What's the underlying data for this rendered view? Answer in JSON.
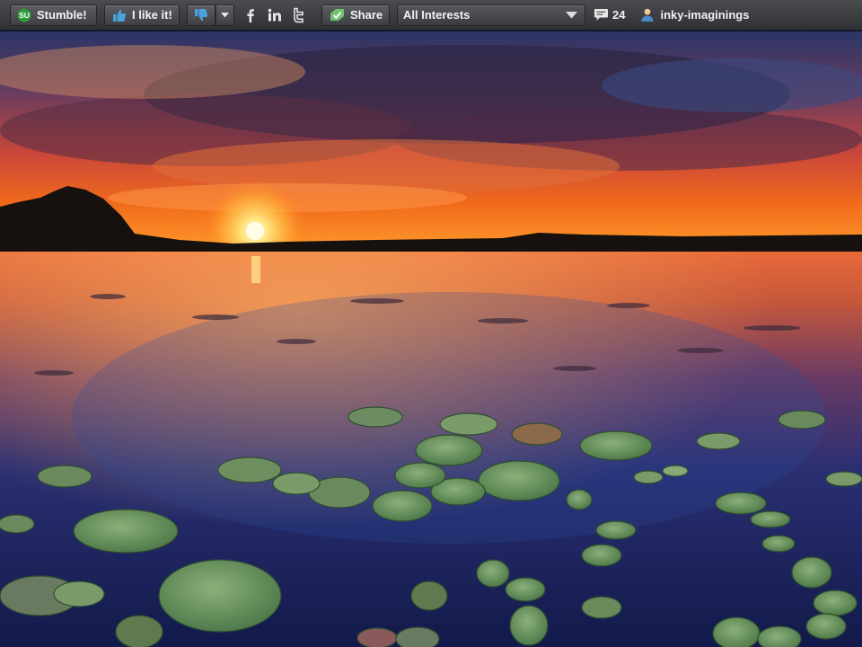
{
  "toolbar": {
    "stumble_label": "Stumble!",
    "like_label": "I like it!",
    "share_label": "Share",
    "interests_selected": "All Interests",
    "comment_count": "24",
    "username": "inky-imaginings"
  },
  "icons": {
    "stumble": "stumbleupon-logo-icon",
    "like": "thumbs-up-icon",
    "dislike": "thumbs-down-icon",
    "dropdown": "chevron-down-icon",
    "facebook": "facebook-icon",
    "linkedin": "linkedin-icon",
    "twitter": "twitter-icon",
    "share": "share-icon",
    "comments": "speech-bubble-icon",
    "user": "user-icon"
  },
  "colors": {
    "toolbar_bg": "#3c3e42",
    "stumble_green": "#2e9b3a",
    "like_blue": "#4aa3df",
    "sky_orange": "#f0621e",
    "water_blue": "#1e2a6a",
    "lily_green": "#5f8c5a"
  }
}
